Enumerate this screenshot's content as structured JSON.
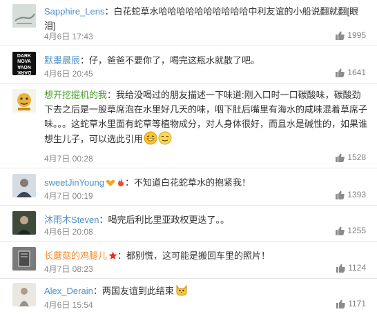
{
  "comments": [
    {
      "username": "Sapphire_Lens",
      "text": "白花蛇草水哈哈哈哈哈哈哈哈哈哈中利友谊的小船说翻就翻[眼泪]",
      "time": "4月6日 17:43",
      "likes": "1995"
    },
    {
      "username": "默墨晨辰",
      "avatar_text": [
        "DARK",
        "NOVA",
        "NOVA",
        "DARK"
      ],
      "text": "仔，爸爸不要你了，喝完这瓶水就散了吧。",
      "time": "4月6日 20:45",
      "likes": "1641"
    },
    {
      "username": "想开挖掘机的我",
      "text": "我给没喝过的朋友描述一下味道:刚入口时一口碳酸味，碳酸劲下去之后是一股草席泡在水里好几天的味，咽下肚后嘴里有海水的咸味混着草席子味。。。这蛇草水里面有蛇草等植物成分，对人身体很好，而且水是碱性的，如果谁想生儿子，可以选此引用",
      "time": "4月7日 00:28",
      "likes": "1528"
    },
    {
      "username": "sweetJinYoung",
      "text": "不知道白花蛇草水的抱紧我！",
      "time": "4月7日 00:19",
      "likes": "1393"
    },
    {
      "username": "沐雨木Steven",
      "text": "喝完后利比里亚政权更迭了。。",
      "time": "4月6日 20:08",
      "likes": "1255"
    },
    {
      "username": "长蘑菇的鸡腿儿",
      "text": "都别慌，这可能是搬回车里的照片！",
      "time": "4月7日 08:23",
      "likes": "1124"
    },
    {
      "username": "Alex_Derain",
      "text": "两国友谊到此结束",
      "time": "4月6日 15:54",
      "likes": "1171"
    }
  ],
  "colors": {
    "username": "#4b90c9",
    "username_orange": "#f0892b",
    "username_green": "#4a9a2a",
    "text": "#333333",
    "meta": "#8a8a8a",
    "divider": "#e6e6e6"
  },
  "icons": [
    "thumb-up-icon",
    "vip-badge-icon",
    "fire-badge-icon",
    "star-badge-icon",
    "grin-emoji-icon",
    "smirk-emoji-icon",
    "cat-emoji-icon"
  ]
}
